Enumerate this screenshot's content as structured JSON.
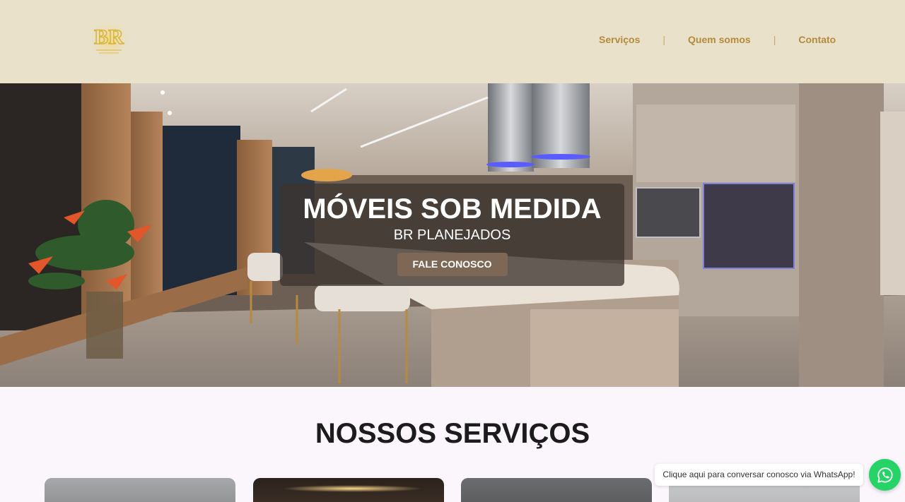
{
  "header": {
    "logo_icon": "br-monogram-logo",
    "nav": [
      {
        "label": "Serviços"
      },
      {
        "separator": "|"
      },
      {
        "label": "Quem somos"
      },
      {
        "separator": "|"
      },
      {
        "label": "Contato"
      }
    ]
  },
  "hero": {
    "image": "kitchen-showroom-photo",
    "title": "MÓVEIS SOB MEDIDA",
    "subtitle": "BR PLANEJADOS",
    "cta_label": "FALE CONOSCO"
  },
  "services": {
    "title": "NOSSOS SERVIÇOS",
    "cards": [
      {
        "image": "service-photo-1"
      },
      {
        "image": "service-photo-2"
      },
      {
        "image": "service-photo-3"
      },
      {
        "image": "service-photo-4"
      }
    ]
  },
  "whatsapp": {
    "tooltip": "Clique aqui para conversar conosco via WhatsApp!",
    "icon": "whatsapp-icon"
  },
  "colors": {
    "header_bg": "#e9e1c9",
    "nav_text": "#b48a3c",
    "page_bg": "#fbf6fb",
    "cta_bg": "#7d6855",
    "whatsapp_green": "#25d366"
  }
}
